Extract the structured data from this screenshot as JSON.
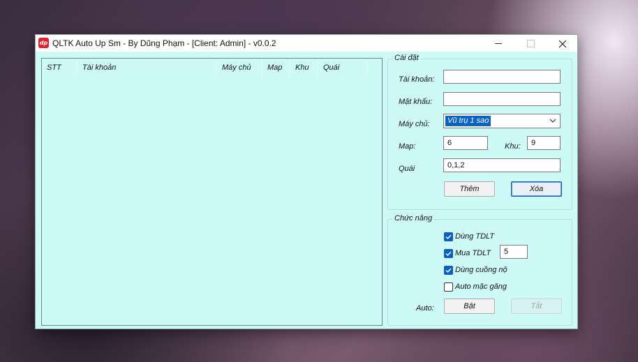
{
  "window": {
    "title": "QLTK Auto Up Sm - By Dũng Phạm - [Client: Admin] - v0.0.2",
    "icon_text": "dp"
  },
  "listview": {
    "columns": [
      "STT",
      "Tài khoản",
      "Máy chủ",
      "Map",
      "Khu",
      "Quái"
    ]
  },
  "settings": {
    "group_title": "Cài đặt",
    "account_label": "Tài khoản:",
    "account_value": "",
    "password_label": "Mật khẩu:",
    "password_value": "",
    "server_label": "Máy chủ:",
    "server_selected": "Vũ trụ 1 sao",
    "map_label": "Map:",
    "map_value": "6",
    "zone_label": "Khu:",
    "zone_value": "9",
    "monster_label": "Quái",
    "monster_value": "0,1,2",
    "add_label": "Thêm",
    "delete_label": "Xóa"
  },
  "functions": {
    "group_title": "Chức năng",
    "use_tdlt_label": "Dùng TDLT",
    "use_tdlt_checked": true,
    "buy_tdlt_label": "Mua TDLT",
    "buy_tdlt_checked": true,
    "buy_tdlt_qty": "5",
    "use_rage_label": "Dùng cuồng nộ",
    "use_rage_checked": true,
    "auto_gloves_label": "Auto mặc găng",
    "auto_gloves_checked": false,
    "auto_label": "Auto:",
    "on_label": "Bật",
    "off_label": "Tắt"
  },
  "colors": {
    "window_bg": "#cdfaf7",
    "accent": "#0b5fc4",
    "app_icon": "#e0212e"
  }
}
